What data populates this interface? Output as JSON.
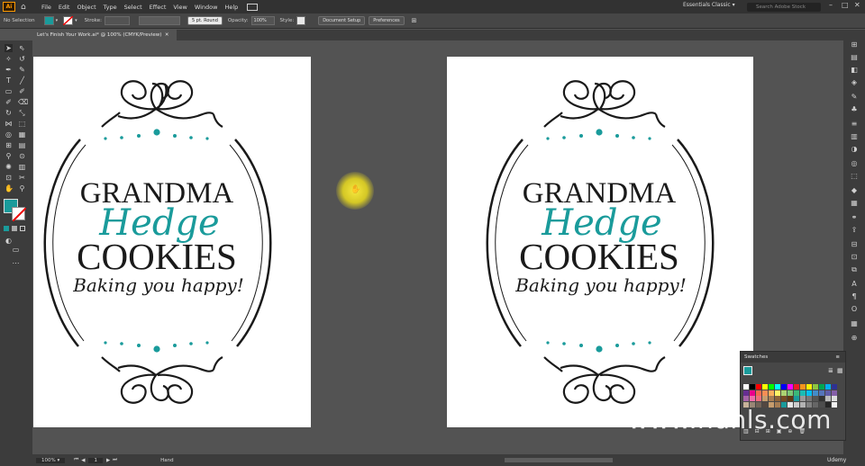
{
  "app": {
    "logo_text": "Ai",
    "menus": [
      "File",
      "Edit",
      "Object",
      "Type",
      "Select",
      "Effect",
      "View",
      "Window",
      "Help"
    ],
    "workspace": "Essentials Classic",
    "stock_placeholder": "Search Adobe Stock"
  },
  "control_bar": {
    "selection": "No Selection",
    "stroke_label": "Stroke:",
    "brush": "5 pt. Round",
    "opacity_label": "Opacity:",
    "opacity_value": "100%",
    "style_label": "Style:",
    "doc_setup": "Document Setup",
    "preferences": "Preferences"
  },
  "document": {
    "tab_title": "Let's Finish Your Work.ai* @ 100% (CMYK/Preview)"
  },
  "logo": {
    "line1": "GRANDMA",
    "line2": "Hedge",
    "line3": "COOKIES",
    "tagline": "Baking you happy!",
    "teal": "#1a9b9b",
    "ink": "#1a1a1a"
  },
  "swatches_panel": {
    "title": "Swatches"
  },
  "status": {
    "zoom": "100%",
    "page": "1",
    "tool": "Hand"
  },
  "watermark": "www.hunls.com",
  "udemy": "Udemy"
}
